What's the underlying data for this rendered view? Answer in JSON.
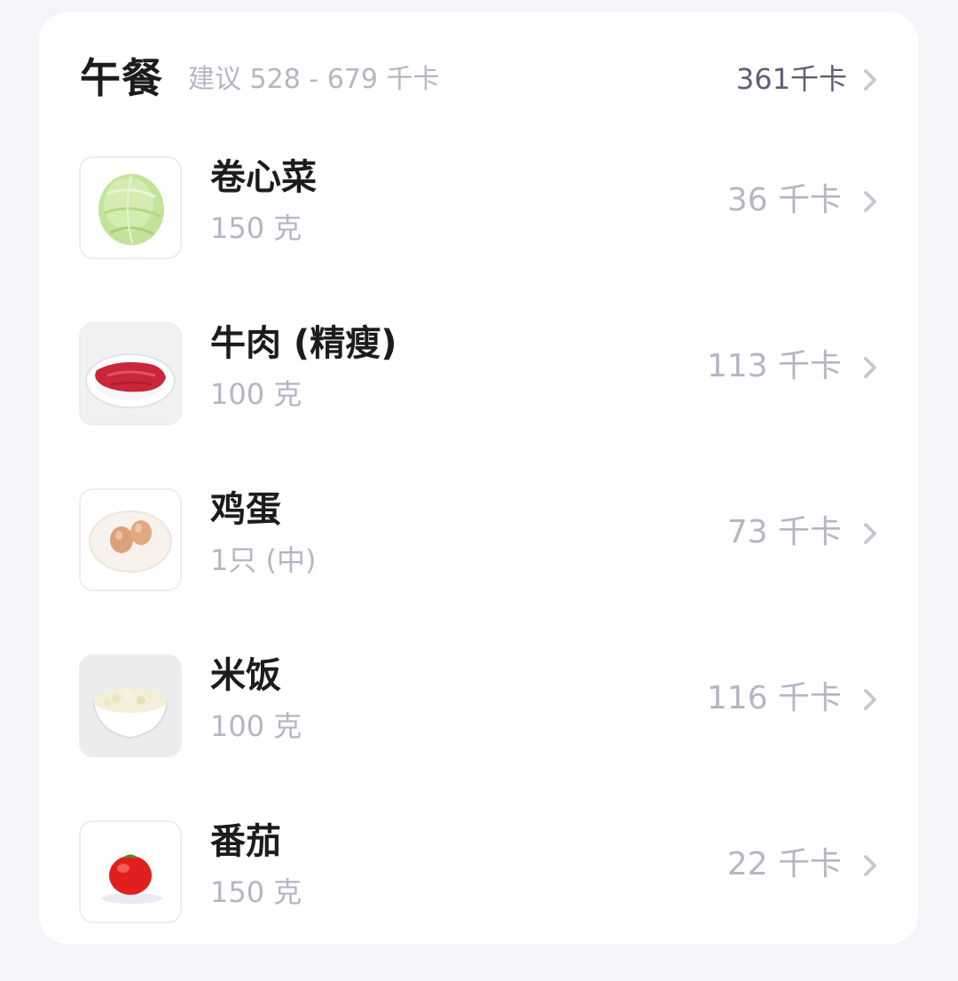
{
  "meal": {
    "title": "午餐",
    "suggestion": "建议 528 - 679 千卡",
    "total": "361千卡"
  },
  "foods": [
    {
      "name": "卷心菜",
      "amount": "150 克",
      "kcal": "36 千卡",
      "icon": "cabbage-image"
    },
    {
      "name": "牛肉 (精瘦)",
      "amount": "100 克",
      "kcal": "113 千卡",
      "icon": "beef-image"
    },
    {
      "name": "鸡蛋",
      "amount": "1只 (中)",
      "kcal": "73 千卡",
      "icon": "egg-image"
    },
    {
      "name": "米饭",
      "amount": "100 克",
      "kcal": "116 千卡",
      "icon": "rice-image"
    },
    {
      "name": "番茄",
      "amount": "150 克",
      "kcal": "22 千卡",
      "icon": "tomato-image"
    }
  ],
  "colors": {
    "background": "#f4f5f9",
    "card": "#ffffff",
    "primary_text": "#1c1c1e",
    "secondary_text": "#b4b6c3",
    "chevron": "#c5c7d1"
  }
}
